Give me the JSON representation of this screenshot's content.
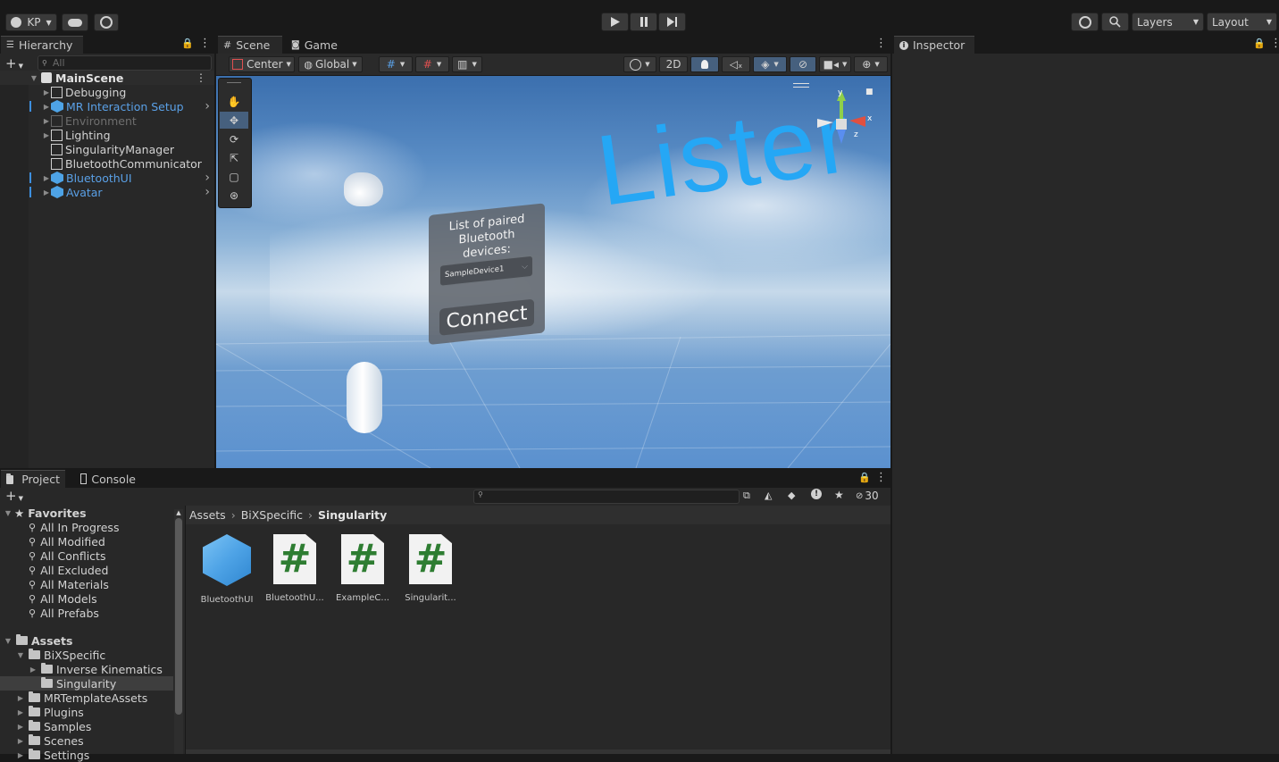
{
  "toolbar": {
    "account": "KP",
    "layers": "Layers",
    "layout": "Layout"
  },
  "hierarchy": {
    "tab": "Hierarchy",
    "search_placeholder": "All",
    "scene": "MainScene",
    "items": [
      {
        "label": "Debugging",
        "style": "normal",
        "expandable": true
      },
      {
        "label": "MR Interaction Setup",
        "style": "prefab",
        "expandable": true
      },
      {
        "label": "Environment",
        "style": "disabled",
        "expandable": true
      },
      {
        "label": "Lighting",
        "style": "normal",
        "expandable": true
      },
      {
        "label": "SingularityManager",
        "style": "normal",
        "expandable": false
      },
      {
        "label": "BluetoothCommunicator",
        "style": "normal",
        "expandable": false
      },
      {
        "label": "BluetoothUI",
        "style": "prefab",
        "expandable": true
      },
      {
        "label": "Avatar",
        "style": "prefab",
        "expandable": true
      }
    ]
  },
  "scene_view": {
    "tab_scene": "Scene",
    "tab_game": "Game",
    "pivot": "Center",
    "space": "Global",
    "mode_2d": "2D",
    "gizmo_y": "y",
    "gizmo_x": "x",
    "gizmo_z": "z",
    "world_text": "Lister",
    "panel_title": "List of paired Bluetooth devices:",
    "dropdown_value": "SampleDevice1",
    "connect_label": "Connect"
  },
  "inspector": {
    "tab": "Inspector"
  },
  "project": {
    "tab_project": "Project",
    "tab_console": "Console",
    "hidden_count": "30",
    "breadcrumb": [
      "Assets",
      "BiXSpecific",
      "Singularity"
    ],
    "favorites_label": "Favorites",
    "favorites": [
      "All In Progress",
      "All Modified",
      "All Conflicts",
      "All Excluded",
      "All Materials",
      "All Models",
      "All Prefabs"
    ],
    "assets_label": "Assets",
    "tree": [
      {
        "label": "BiXSpecific",
        "depth": 1,
        "open": true
      },
      {
        "label": "Inverse Kinematics",
        "depth": 2,
        "open": false
      },
      {
        "label": "Singularity",
        "depth": 2,
        "open": false,
        "selected": true
      },
      {
        "label": "MRTemplateAssets",
        "depth": 1,
        "open": false
      },
      {
        "label": "Plugins",
        "depth": 1,
        "open": false
      },
      {
        "label": "Samples",
        "depth": 1,
        "open": false
      },
      {
        "label": "Scenes",
        "depth": 1,
        "open": false
      },
      {
        "label": "Settings",
        "depth": 1,
        "open": false
      }
    ],
    "assets": [
      {
        "label": "BluetoothUI",
        "kind": "prefab"
      },
      {
        "label": "BluetoothU...",
        "kind": "script"
      },
      {
        "label": "ExampleC...",
        "kind": "script"
      },
      {
        "label": "Singularit...",
        "kind": "script"
      }
    ]
  },
  "colors": {
    "accent_blue": "#3d8fe0",
    "prefab_text": "#5aa0e6",
    "script_hash": "#2e7d32"
  }
}
